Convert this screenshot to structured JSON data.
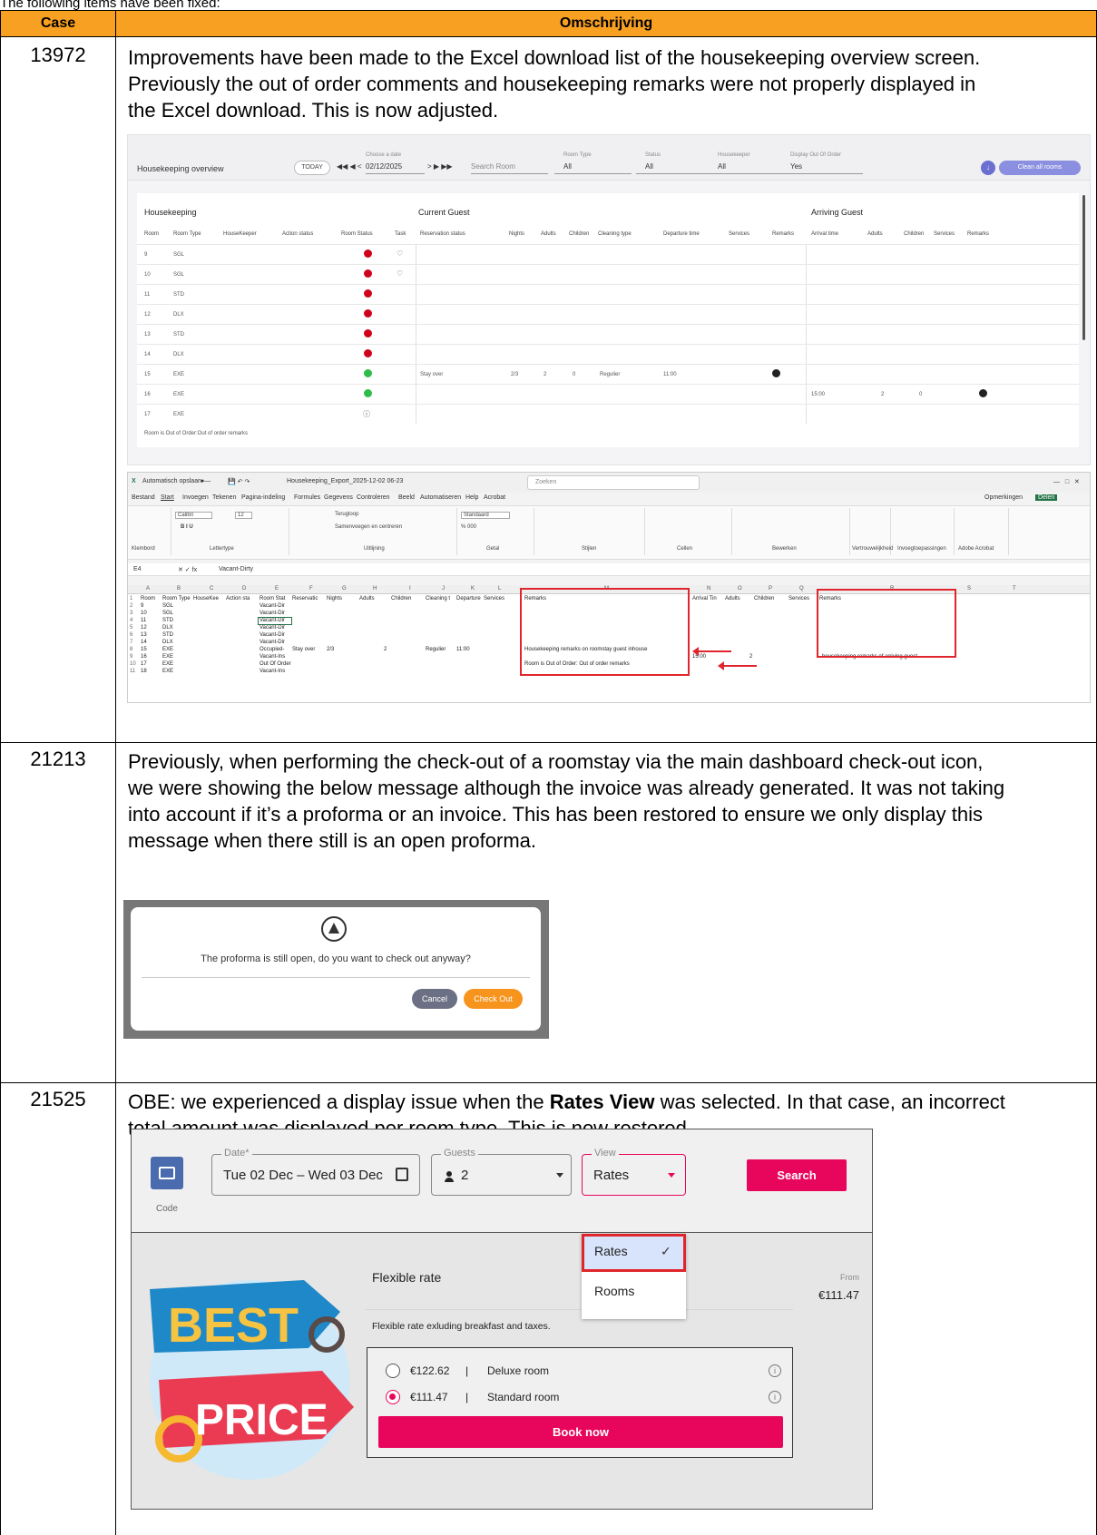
{
  "intro": "The following items have been fixed:",
  "table": {
    "headers": {
      "case": "Case",
      "description": "Omschrijving"
    },
    "header_color": "#f7a021",
    "rows": [
      {
        "case": "13972",
        "lines": [
          "Improvements have been made to the Excel download list of the housekeeping overview screen.",
          "Previously the out of order comments and housekeeping remarks were not properly displayed in",
          "the Excel download. This is now adjusted."
        ]
      },
      {
        "case": "21213",
        "lines": [
          "Previously, when performing the check-out of a roomstay via the main dashboard check-out icon,",
          "we were showing the below message although the invoice was already generated. It was not taking",
          "into account if it’s a proforma or an invoice. This has been restored to ensure we only display this",
          "message when there still is an open proforma."
        ]
      },
      {
        "case": "21525",
        "line1_pre": "OBE: we experienced a display issue when the ",
        "line1_bold": "Rates View",
        "line1_post": " was selected. In that case, an incorrect",
        "line2": "total amount was displayed per room type. This is now restored."
      }
    ]
  },
  "housekeeping": {
    "title": "Housekeeping overview",
    "today": "TODAY",
    "nav_back": "◀◀ ◀ <",
    "date_label": "Choose a date",
    "date": "02/12/2025",
    "nav_fwd": "> ▶ ▶▶",
    "search": "Search Room",
    "room_type_label": "Room Type",
    "room_type_value": "All",
    "status_label": "Status",
    "status_value": "All",
    "housekeeper_label": "Housekeeper",
    "housekeeper_value": "All",
    "ooo_label": "Display Out Of Order",
    "ooo_value": "Yes",
    "clean_all": "Clean all rooms",
    "sections": [
      "Housekeeping",
      "Current Guest",
      "Arriving Guest"
    ],
    "columns": [
      "Room",
      "Room Type",
      "HouseKeeper",
      "Action status",
      "Room Status",
      "Task",
      "Reservation status",
      "Nights",
      "Adults",
      "Children",
      "Cleaning type",
      "Departure time",
      "Services",
      "Remarks",
      "Arrival time",
      "Adults",
      "Children",
      "Services",
      "Remarks"
    ],
    "rows": [
      {
        "room": "9",
        "type": "SGL",
        "status": "red",
        "task": true
      },
      {
        "room": "10",
        "type": "SGL",
        "status": "red",
        "task": true
      },
      {
        "room": "11",
        "type": "STD",
        "status": "red"
      },
      {
        "room": "12",
        "type": "DLX",
        "status": "red"
      },
      {
        "room": "13",
        "type": "STD",
        "status": "red"
      },
      {
        "room": "14",
        "type": "DLX",
        "status": "red"
      },
      {
        "room": "15",
        "type": "EXE",
        "status": "green",
        "reservation": "Stay over",
        "nights": "2/3",
        "adults": "2",
        "children": "0",
        "cleaning": "Regulier",
        "departure": "11:00"
      },
      {
        "room": "16",
        "type": "EXE",
        "status": "green",
        "arrival": "15:00",
        "arr_adults": "2",
        "arr_children": "0"
      },
      {
        "room": "17",
        "type": "EXE",
        "status": "ooo"
      }
    ],
    "footer": "Room is Out of Order:Out of order remarks"
  },
  "excel": {
    "autosave": "Automatisch opslaan",
    "filename": "Housekeeping_Export_2025-12-02 06-23",
    "search": "Zoeken",
    "menu": [
      "Bestand",
      "Start",
      "Invoegen",
      "Tekenen",
      "Pagina-indeling",
      "Formules",
      "Gegevens",
      "Controleren",
      "Beeld",
      "Automatiseren",
      "Help",
      "Acrobat"
    ],
    "comments_btn": "Opmerkingen",
    "share_btn": "Delen",
    "ribbon_groups": [
      "Klembord",
      "Lettertype",
      "Uitlijning",
      "Getal",
      "Stijlen",
      "Cellen",
      "Bewerken",
      "Vertrouwelijkheid",
      "Invoegtoepassingen",
      "Adobe Acrobat"
    ],
    "font": "Calibri",
    "font_size": "12",
    "number_format": "Standaard",
    "wrap": "Terugloop",
    "merge": "Samenvoegen en centreren",
    "cell_ref": "E4",
    "formula": "Vacant-Dirty",
    "col_letters": [
      "A",
      "B",
      "C",
      "D",
      "E",
      "F",
      "G",
      "H",
      "I",
      "J",
      "K",
      "L",
      "M",
      "N",
      "O",
      "P",
      "Q",
      "R",
      "S",
      "T"
    ],
    "header_row": [
      "Room",
      "Room Type",
      "HouseKee",
      "Action sta",
      "Room Stat",
      "Reservatic",
      "Nights",
      "Adults",
      "Children",
      "Cleaning t",
      "Departure",
      "Services",
      "Remarks",
      "Arrival Tin",
      "Adults",
      "Children",
      "Services",
      "Remarks"
    ],
    "rows": [
      [
        "2",
        "9",
        "SGL",
        "Vacant-Dir"
      ],
      [
        "3",
        "10",
        "SGL",
        "Vacant-Dir"
      ],
      [
        "4",
        "11",
        "STD",
        "Vacant-Dir"
      ],
      [
        "5",
        "12",
        "DLX",
        "Vacant-Dir"
      ],
      [
        "6",
        "13",
        "STD",
        "Vacant-Dir"
      ],
      [
        "7",
        "14",
        "DLX",
        "Vacant-Dir"
      ],
      [
        "8",
        "15",
        "EXE",
        "Occupied-",
        "Stay over",
        "2/3",
        "2",
        "Regulier",
        "11:00",
        "Housekeeping remarks on roomstay guest inhouse"
      ],
      [
        "9",
        "16",
        "EXE",
        "Vacant-Ins",
        "15:00",
        "2",
        "housekeeping remarks of arriving guest"
      ],
      [
        "10",
        "17",
        "EXE",
        "Out Of Order",
        "Room is Out of Order: Out of order remarks"
      ],
      [
        "11",
        "18",
        "EXE",
        "Vacant-Ins"
      ]
    ]
  },
  "dialog": {
    "message": "The proforma is still open, do you want to check out anyway?",
    "cancel": "Cancel",
    "checkout": "Check Out"
  },
  "obe": {
    "code_label": "Code",
    "date_label": "Date*",
    "date_value": "Tue 02 Dec – Wed 03 Dec",
    "guests_label": "Guests",
    "guests_value": "2",
    "view_label": "View",
    "view_value": "Rates",
    "search": "Search",
    "view_options": [
      "Rates",
      "Rooms"
    ],
    "rate_title": "Flexible rate",
    "from_label": "From",
    "from_price": "€111.47",
    "rate_desc": "Flexible rate exluding breakfast and taxes.",
    "options": [
      {
        "price": "€122.62",
        "room": "Deluxe room",
        "selected": false
      },
      {
        "price": "€111.47",
        "room": "Standard room",
        "selected": true
      }
    ],
    "book": "Book now",
    "image_text_1": "BEST",
    "image_text_2": "PRICE",
    "accent": "#e8065d"
  }
}
